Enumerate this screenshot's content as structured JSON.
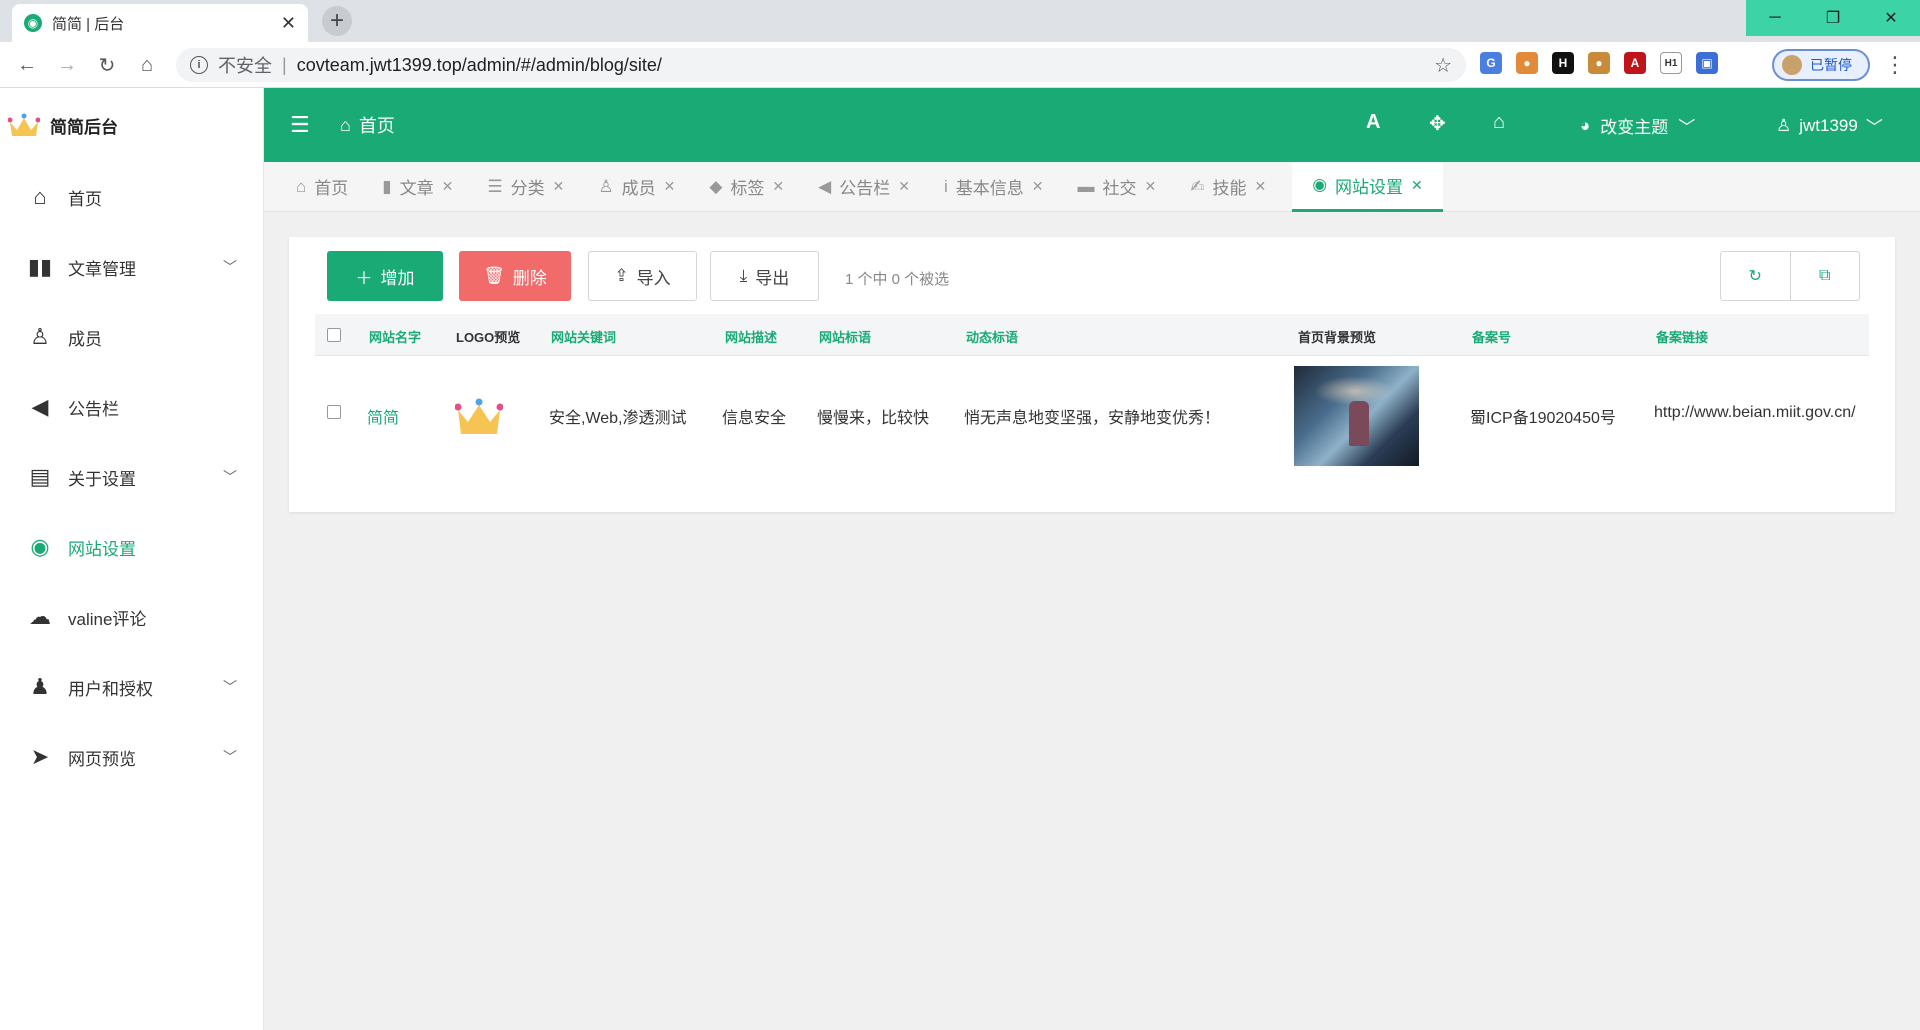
{
  "browser": {
    "tab_title": "简简 | 后台",
    "insecure_label": "不安全",
    "url": "covteam.jwt1399.top/admin/#/admin/blog/site/",
    "paused_label": "已暂停"
  },
  "app": {
    "logo_text": "简简后台",
    "header": {
      "home_label": "首页",
      "theme_label": "改变主题",
      "user_label": "jwt1399"
    },
    "sidebar": {
      "items": [
        {
          "label": "首页",
          "icon": "home-icon",
          "has_children": false
        },
        {
          "label": "文章管理",
          "icon": "book-icon",
          "has_children": true
        },
        {
          "label": "成员",
          "icon": "user-icon",
          "has_children": false
        },
        {
          "label": "公告栏",
          "icon": "bullhorn-icon",
          "has_children": false
        },
        {
          "label": "关于设置",
          "icon": "id-card-icon",
          "has_children": true
        },
        {
          "label": "网站设置",
          "icon": "globe-icon",
          "has_children": false,
          "active": true
        },
        {
          "label": "valine评论",
          "icon": "comments-icon",
          "has_children": false
        },
        {
          "label": "用户和授权",
          "icon": "user-lock-icon",
          "has_children": true
        },
        {
          "label": "网页预览",
          "icon": "paper-plane-icon",
          "has_children": true
        }
      ]
    },
    "tabs": [
      {
        "label": "首页",
        "icon": "home-icon",
        "closable": false
      },
      {
        "label": "文章",
        "icon": "book-icon",
        "closable": true
      },
      {
        "label": "分类",
        "icon": "list-icon",
        "closable": true
      },
      {
        "label": "成员",
        "icon": "user-icon",
        "closable": true
      },
      {
        "label": "标签",
        "icon": "tags-icon",
        "closable": true
      },
      {
        "label": "公告栏",
        "icon": "bullhorn-icon",
        "closable": true
      },
      {
        "label": "基本信息",
        "icon": "info-icon",
        "closable": true
      },
      {
        "label": "社交",
        "icon": "comment-icon",
        "closable": true
      },
      {
        "label": "技能",
        "icon": "skill-icon",
        "closable": true
      },
      {
        "label": "网站设置",
        "icon": "globe-icon",
        "closable": true,
        "active": true
      }
    ],
    "toolbar": {
      "add_label": "增加",
      "delete_label": "删除",
      "import_label": "导入",
      "export_label": "导出",
      "selection_info": "1 个中 0 个被选"
    },
    "table": {
      "columns": [
        "网站名字",
        "LOGO预览",
        "网站关键词",
        "网站描述",
        "网站标语",
        "动态标语",
        "首页背景预览",
        "备案号",
        "备案链接"
      ],
      "rows": [
        {
          "name": "简简",
          "keywords": "安全,Web,渗透测试",
          "description": "信息安全",
          "slogan": "慢慢来，比较快",
          "dynamic_slogan": "悄无声息地变坚强，安静地变优秀！",
          "icp": "蜀ICP备19020450号",
          "icp_link": "http://www.beian.miit.gov.cn/"
        }
      ]
    }
  },
  "colors": {
    "brand": "#1aaa75",
    "danger": "#f26b6b"
  }
}
